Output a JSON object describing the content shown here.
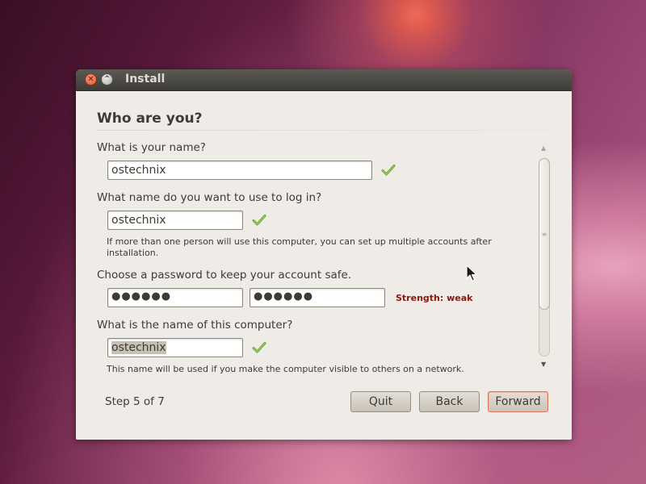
{
  "window": {
    "title": "Install"
  },
  "page": {
    "heading": "Who are you?",
    "name": {
      "label": "What is your name?",
      "value": "ostechnix",
      "valid": true
    },
    "login": {
      "label": "What name do you want to use to log in?",
      "value": "ostechnix",
      "valid": true,
      "hint_line1": "If more than one person will use this computer, you can set up multiple accounts after",
      "hint_line2": "installation."
    },
    "password": {
      "label": "Choose a password to keep your account safe.",
      "value_masked": "●●●●●●",
      "confirm_masked": "●●●●●●",
      "strength": "Strength: weak",
      "strength_color": "#8b1a0f"
    },
    "computer": {
      "label": "What is the name of this computer?",
      "value": "ostechnix",
      "valid": true,
      "hint": "This name will be used if you make the computer visible to others on a network."
    }
  },
  "footer": {
    "step": "Step 5 of 7",
    "quit_label": "Quit",
    "back_label": "Back",
    "forward_label": "Forward"
  },
  "icons": {
    "close": "close-icon",
    "maximize": "maximize-icon",
    "check": "check-icon",
    "scroll_up": "scroll-up-arrow-icon",
    "scroll_down": "scroll-down-arrow-icon",
    "cursor": "mouse-pointer-icon"
  },
  "colors": {
    "check_green": "#6aa32a",
    "accent_orange": "#e0735a"
  }
}
